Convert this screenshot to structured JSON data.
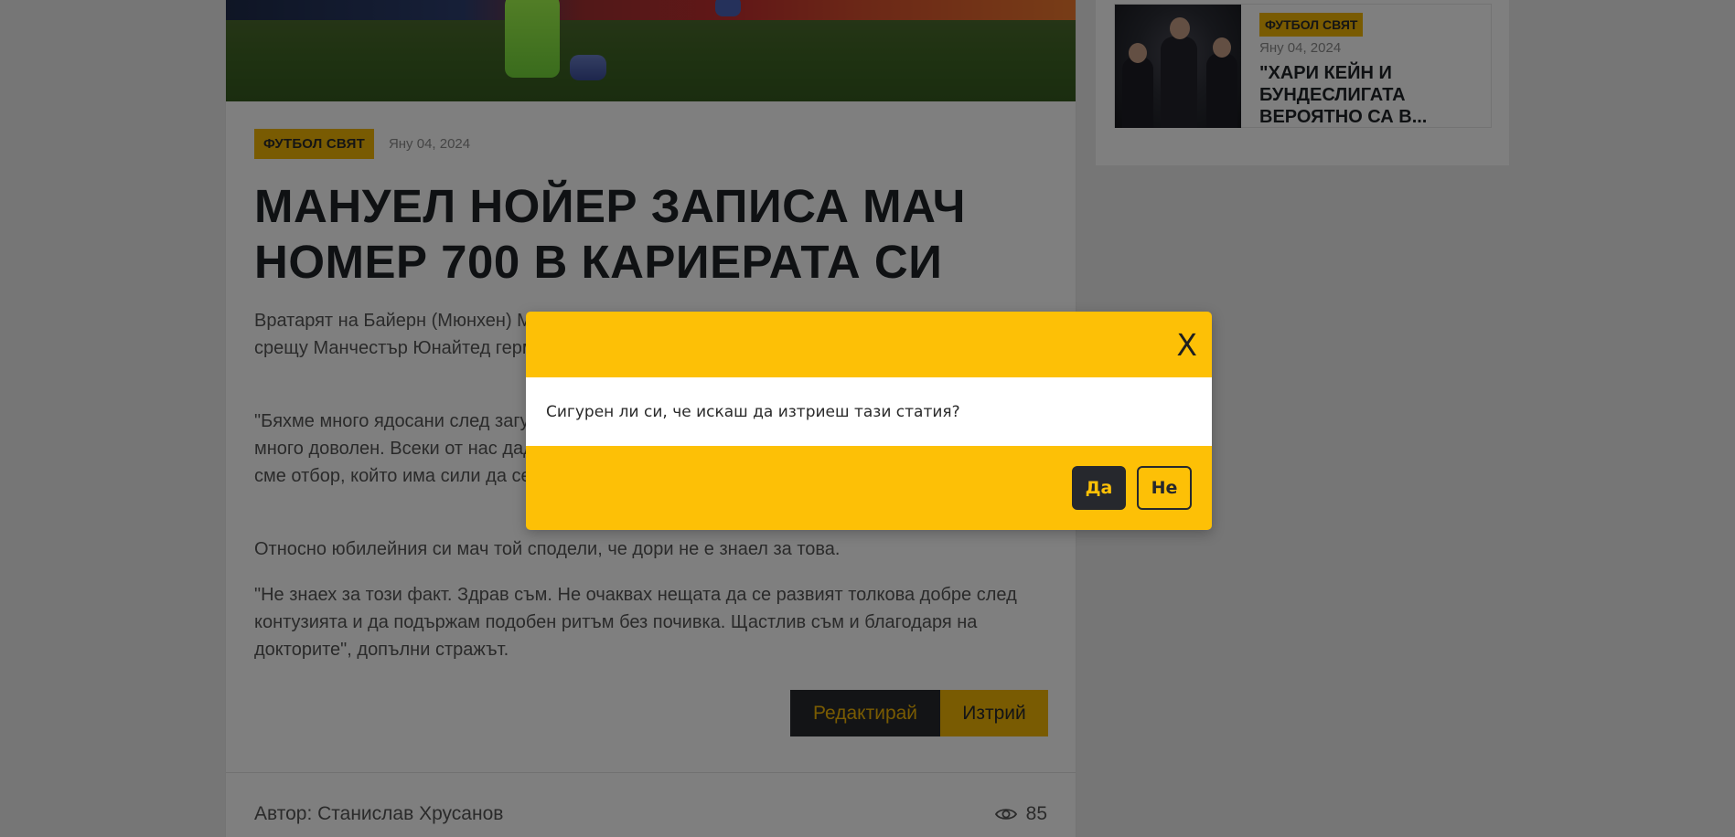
{
  "article": {
    "category": "ФУТБОЛ СВЯТ",
    "date": "Яну 04, 2024",
    "title": "МАНУЕЛ НОЙЕР ЗАПИСА МАЧ НОМЕР 700 В КАРИЕРАТА СИ",
    "paragraphs": [
      "Вратарят на Байерн (Мюнхен) Мануел Нойер записа юбилеен мач в кариерата си. В двубоя срещу Манчестър Юнайтед германецът изигра своя мач №700 на клубно ниво.",
      "\"Бяхме много ядосани след загубата и днес показахме правилната реакция. Треньорът бе много доволен. Всеки от нас даде максимума от себе си за победата. Трябва да покажем, че сме отбор, който има сили да се пребори",
      "Относно юбилейния си мач той сподели, че дори не е знаел за това.",
      "\"Не знаех за този факт. Здрав съм. Не очаквах нещата да се развият толкова добре след контузията и да подържам подобен ритъм без почивка. Щастлив съм и благодаря на докторите\", допълни стражът."
    ],
    "edit_label": "Редактирай",
    "delete_label": "Изтрий",
    "author": "Автор: Станислав Хрусанов",
    "views": "85",
    "views_icon": "eye-icon"
  },
  "sidebar": {
    "card": {
      "category": "ФУТБОЛ СВЯТ",
      "date": "Яну 04, 2024",
      "title": "\"ХАРИ КЕЙН И БУНДЕСЛИГАТА ВЕРОЯТНО СА В..."
    }
  },
  "modal": {
    "close_label": "X",
    "message": "Сигурен ли си, че искаш да изтриеш тази статия?",
    "yes_label": "Да",
    "no_label": "Не"
  },
  "colors": {
    "accent": "#fdc006",
    "dark": "#26282d",
    "overlay": "rgba(0,0,0,0.5)"
  }
}
